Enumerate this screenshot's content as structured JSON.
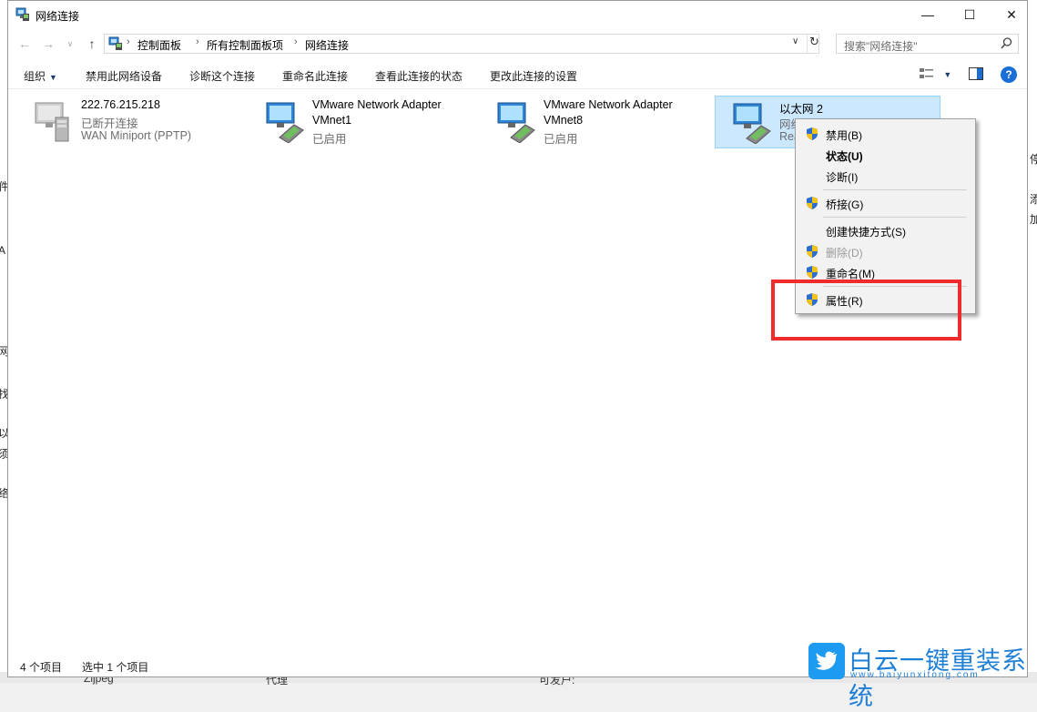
{
  "window": {
    "title": "网络连接",
    "min_glyph": "—",
    "max_glyph": "☐",
    "close_glyph": "✕"
  },
  "nav": {
    "back_glyph": "←",
    "forward_glyph": "→",
    "recent_glyph": "∨",
    "up_glyph": "↑",
    "breadcrumb": [
      "控制面板",
      "所有控制面板项",
      "网络连接"
    ],
    "crumb_sep": "›",
    "dropdown_glyph": "∨",
    "refresh_glyph": "↻",
    "search_placeholder": "搜索\"网络连接\""
  },
  "toolbar": {
    "organize": "组织",
    "organize_caret": "▼",
    "disable": "禁用此网络设备",
    "diagnose": "诊断这个连接",
    "rename": "重命名此连接",
    "view_status": "查看此连接的状态",
    "change_settings": "更改此连接的设置",
    "view_caret": "▼",
    "help": "?"
  },
  "connections": [
    {
      "name": "222.76.215.218",
      "line2": "已断开连接",
      "line3": "WAN Miniport (PPTP)"
    },
    {
      "name": "VMware Network Adapter",
      "line2": "VMnet1",
      "line3": "已启用"
    },
    {
      "name": "VMware Network Adapter",
      "line2": "VMnet8",
      "line3": "已启用"
    },
    {
      "name": "以太网 2",
      "line2": "网络",
      "line3": "Realte"
    }
  ],
  "context_menu": [
    {
      "label": "禁用(B)",
      "shield": true
    },
    {
      "label": "状态(U)",
      "bold": true
    },
    {
      "label": "诊断(I)"
    },
    {
      "label": "桥接(G)",
      "shield": true
    },
    {
      "label": "创建快捷方式(S)"
    },
    {
      "label": "删除(D)",
      "shield": true,
      "disabled": true
    },
    {
      "label": "重命名(M)",
      "shield": true
    },
    {
      "label": "属性(R)",
      "shield": true
    }
  ],
  "status": {
    "count": "4 个项目",
    "selected": "选中 1 个项目"
  },
  "background": {
    "left_chars": [
      "网",
      "件",
      "A",
      "网",
      "找",
      "以",
      "须",
      "络"
    ],
    "right_chars": [
      "停",
      "添",
      "加"
    ],
    "bottom_texts": [
      "Zijpeg",
      "代理",
      "可发户:"
    ]
  },
  "watermark": {
    "title": "白云一键重装系统",
    "url": "www.baiyunxitong.com"
  },
  "colors": {
    "selection": "#cce8ff",
    "highlight_box": "#f02b2b",
    "accent": "#1a6fd6"
  }
}
